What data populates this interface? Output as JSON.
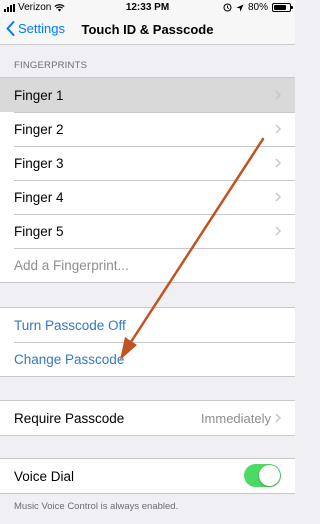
{
  "status_bar": {
    "carrier": "Verizon",
    "time": "12:33 PM",
    "battery_percent": "80%",
    "battery_level": 0.8
  },
  "nav": {
    "back_label": "Settings",
    "title": "Touch ID & Passcode"
  },
  "fingerprints": {
    "header": "FINGERPRINTS",
    "items": [
      {
        "label": "Finger 1"
      },
      {
        "label": "Finger 2"
      },
      {
        "label": "Finger 3"
      },
      {
        "label": "Finger 4"
      },
      {
        "label": "Finger 5"
      }
    ],
    "add_label": "Add a Fingerprint..."
  },
  "passcode": {
    "turn_off_label": "Turn Passcode Off",
    "change_label": "Change Passcode"
  },
  "require": {
    "label": "Require Passcode",
    "value": "Immediately"
  },
  "voice_dial": {
    "label": "Voice Dial",
    "enabled": true,
    "footer": "Music Voice Control is always enabled."
  },
  "colors": {
    "accent": "#007aff",
    "link": "#3478c6",
    "toggle_on": "#4cd964",
    "annotation_arrow": "#c0531f"
  },
  "icons": {
    "back": "chevron-left-icon",
    "disclosure": "chevron-right-icon",
    "wifi": "wifi-icon",
    "location": "location-arrow-icon",
    "alarm": "alarm-icon"
  }
}
